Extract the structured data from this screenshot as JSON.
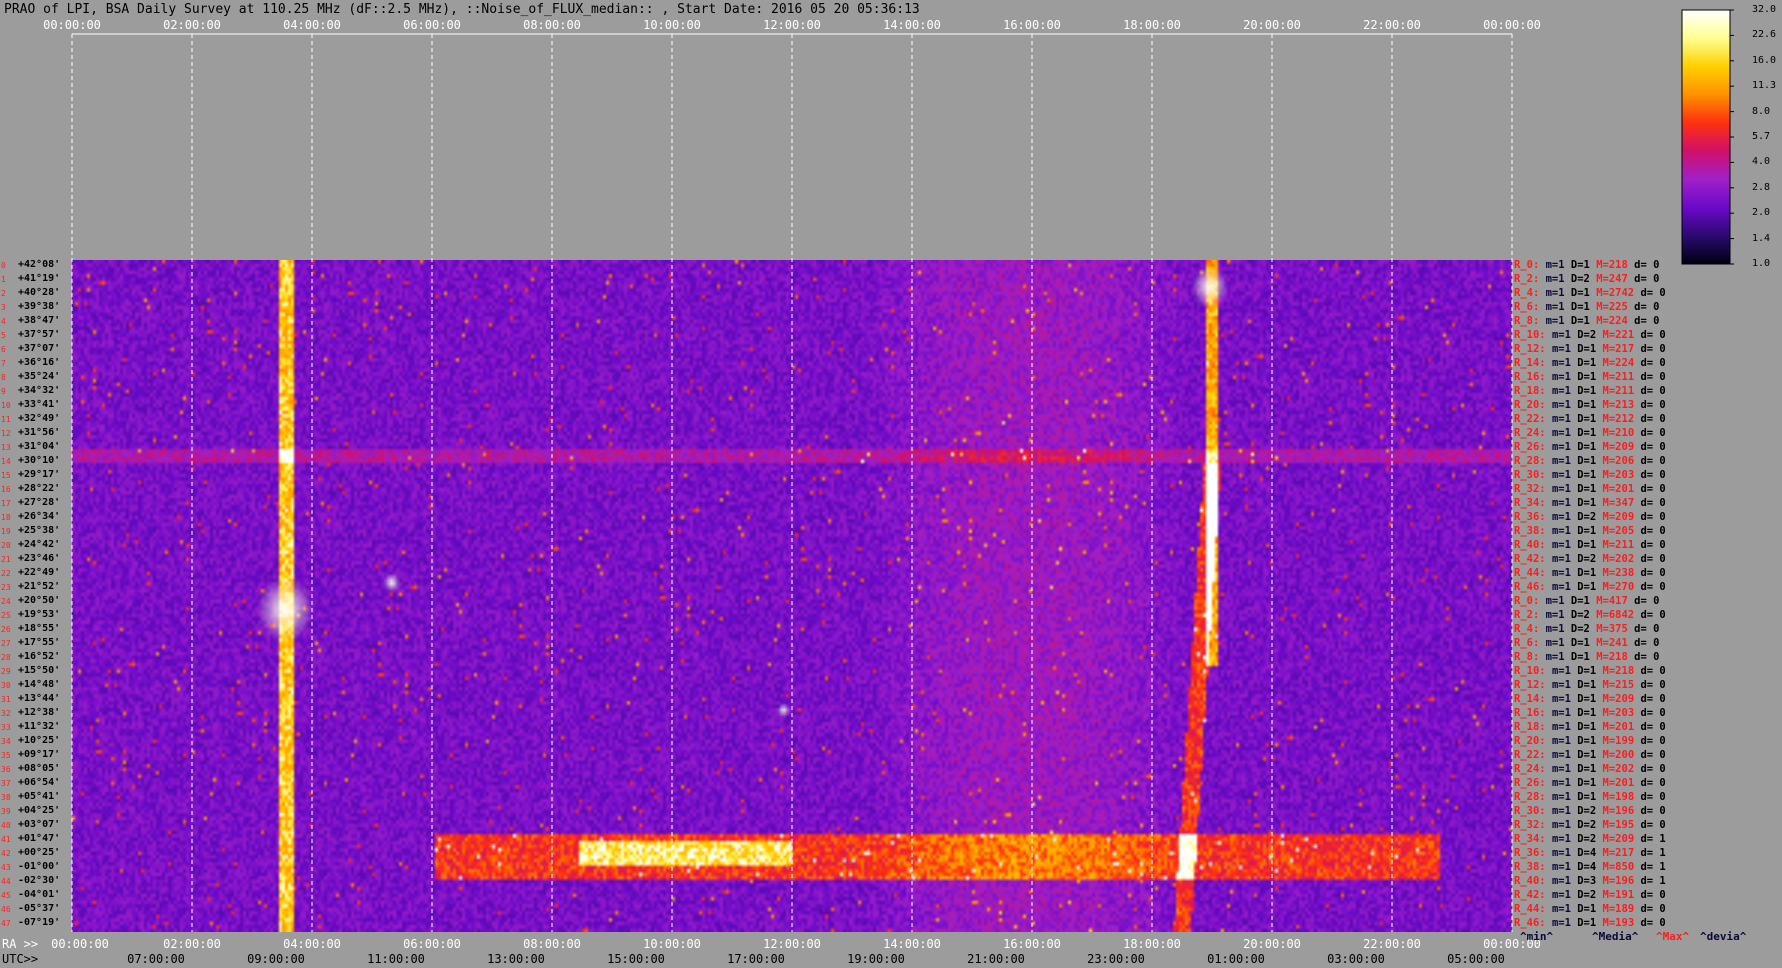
{
  "title": "PRAO of LPI, BSA Daily Survey at 110.25 MHz (dF::2.5 MHz), ::Noise_of_FLUX_median:: , Start Date: 2016 05 20 05:36:13",
  "chart_data": {
    "type": "heatmap",
    "title": "PRAO of LPI, BSA Daily Survey at 110.25 MHz (dF::2.5 MHz), ::Noise_of_FLUX_median:: , Start Date: 2016 05 20 05:36:13",
    "x_top_ticks": [
      "00:00:00",
      "02:00:00",
      "04:00:00",
      "06:00:00",
      "08:00:00",
      "10:00:00",
      "12:00:00",
      "14:00:00",
      "16:00:00",
      "18:00:00",
      "20:00:00",
      "22:00:00",
      "00:00:00"
    ],
    "x_ra_ticks": [
      "00:00:00",
      "02:00:00",
      "04:00:00",
      "06:00:00",
      "08:00:00",
      "10:00:00",
      "12:00:00",
      "14:00:00",
      "16:00:00",
      "18:00:00",
      "20:00:00",
      "22:00:00",
      "00:00:00"
    ],
    "x_utc_ticks": [
      "07:00:00",
      "09:00:00",
      "11:00:00",
      "13:00:00",
      "15:00:00",
      "17:00:00",
      "19:00:00",
      "21:00:00",
      "23:00:00",
      "01:00:00",
      "03:00:00",
      "05:00:00"
    ],
    "ra_prefix": "RA >>",
    "utc_prefix": "UTC>>",
    "declinations": [
      "+42°08'",
      "+41°19'",
      "+40°28'",
      "+39°38'",
      "+38°47'",
      "+37°57'",
      "+37°07'",
      "+36°16'",
      "+35°24'",
      "+34°32'",
      "+33°41'",
      "+32°49'",
      "+31°56'",
      "+31°04'",
      "+30°10'",
      "+29°17'",
      "+28°22'",
      "+27°28'",
      "+26°34'",
      "+25°38'",
      "+24°42'",
      "+23°46'",
      "+22°49'",
      "+21°52'",
      "+20°50'",
      "+19°53'",
      "+18°55'",
      "+17°55'",
      "+16°52'",
      "+15°50'",
      "+14°48'",
      "+13°44'",
      "+12°38'",
      "+11°32'",
      "+10°25'",
      "+09°17'",
      "+08°05'",
      "+06°54'",
      "+05°41'",
      "+04°25'",
      "+03°07'",
      "+01°47'",
      "+00°25'",
      "-01°00'",
      "-02°30'",
      "-04°01'",
      "-05°37'",
      "-07°19'"
    ],
    "row_indices": [
      "0",
      "1",
      "2",
      "3",
      "4",
      "5",
      "6",
      "7",
      "8",
      "9",
      "10",
      "11",
      "12",
      "13",
      "14",
      "15",
      "16",
      "17",
      "18",
      "19",
      "20",
      "21",
      "22",
      "23",
      "24",
      "25",
      "26",
      "27",
      "28",
      "29",
      "30",
      "31",
      "32",
      "33",
      "34",
      "35",
      "36",
      "37",
      "38",
      "39",
      "40",
      "41",
      "42",
      "43",
      "44",
      "45",
      "46",
      "47"
    ],
    "colorbar": {
      "ticks": [
        "32.0",
        "22.6",
        "16.0",
        "11.3",
        "8.0",
        "5.7",
        "4.0",
        "2.8",
        "2.0",
        "1.4",
        "1.0"
      ],
      "colors": [
        "#ffffff",
        "#ffff90",
        "#ffd000",
        "#ff9000",
        "#ff3010",
        "#d0106a",
        "#a020c8",
        "#6a0ac8",
        "#2a0a70",
        "#000010"
      ]
    },
    "stats": [
      {
        "r": "R_0:",
        "m": "m=1",
        "D": "D=1",
        "M": "M=218",
        "d": "d= 0"
      },
      {
        "r": "R_2:",
        "m": "m=1",
        "D": "D=2",
        "M": "M=247",
        "d": "d= 0"
      },
      {
        "r": "R_4:",
        "m": "m=1",
        "D": "D=1",
        "M": "M=2742",
        "d": "d= 0"
      },
      {
        "r": "R_6:",
        "m": "m=1",
        "D": "D=1",
        "M": "M=225",
        "d": "d= 0"
      },
      {
        "r": "R_8:",
        "m": "m=1",
        "D": "D=1",
        "M": "M=224",
        "d": "d= 0"
      },
      {
        "r": "R_10:",
        "m": "m=1",
        "D": "D=2",
        "M": "M=221",
        "d": "d= 0"
      },
      {
        "r": "R_12:",
        "m": "m=1",
        "D": "D=1",
        "M": "M=217",
        "d": "d= 0"
      },
      {
        "r": "R_14:",
        "m": "m=1",
        "D": "D=1",
        "M": "M=224",
        "d": "d= 0"
      },
      {
        "r": "R_16:",
        "m": "m=1",
        "D": "D=1",
        "M": "M=211",
        "d": "d= 0"
      },
      {
        "r": "R_18:",
        "m": "m=1",
        "D": "D=1",
        "M": "M=211",
        "d": "d= 0"
      },
      {
        "r": "R_20:",
        "m": "m=1",
        "D": "D=1",
        "M": "M=213",
        "d": "d= 0"
      },
      {
        "r": "R_22:",
        "m": "m=1",
        "D": "D=1",
        "M": "M=212",
        "d": "d= 0"
      },
      {
        "r": "R_24:",
        "m": "m=1",
        "D": "D=1",
        "M": "M=210",
        "d": "d= 0"
      },
      {
        "r": "R_26:",
        "m": "m=1",
        "D": "D=1",
        "M": "M=209",
        "d": "d= 0"
      },
      {
        "r": "R_28:",
        "m": "m=1",
        "D": "D=1",
        "M": "M=206",
        "d": "d= 0"
      },
      {
        "r": "R_30:",
        "m": "m=1",
        "D": "D=1",
        "M": "M=203",
        "d": "d= 0"
      },
      {
        "r": "R_32:",
        "m": "m=1",
        "D": "D=1",
        "M": "M=201",
        "d": "d= 0"
      },
      {
        "r": "R_34:",
        "m": "m=1",
        "D": "D=1",
        "M": "M=347",
        "d": "d= 0"
      },
      {
        "r": "R_36:",
        "m": "m=1",
        "D": "D=2",
        "M": "M=209",
        "d": "d= 0"
      },
      {
        "r": "R_38:",
        "m": "m=1",
        "D": "D=1",
        "M": "M=205",
        "d": "d= 0"
      },
      {
        "r": "R_40:",
        "m": "m=1",
        "D": "D=1",
        "M": "M=211",
        "d": "d= 0"
      },
      {
        "r": "R_42:",
        "m": "m=1",
        "D": "D=2",
        "M": "M=202",
        "d": "d= 0"
      },
      {
        "r": "R_44:",
        "m": "m=1",
        "D": "D=1",
        "M": "M=238",
        "d": "d= 0"
      },
      {
        "r": "R_46:",
        "m": "m=1",
        "D": "D=1",
        "M": "M=270",
        "d": "d= 0"
      },
      {
        "r": "R_0:",
        "m": "m=1",
        "D": "D=1",
        "M": "M=417",
        "d": "d= 0"
      },
      {
        "r": "R_2:",
        "m": "m=1",
        "D": "D=2",
        "M": "M=6842",
        "d": "d= 0"
      },
      {
        "r": "R_4:",
        "m": "m=1",
        "D": "D=2",
        "M": "M=375",
        "d": "d= 0"
      },
      {
        "r": "R_6:",
        "m": "m=1",
        "D": "D=1",
        "M": "M=241",
        "d": "d= 0"
      },
      {
        "r": "R_8:",
        "m": "m=1",
        "D": "D=1",
        "M": "M=218",
        "d": "d= 0"
      },
      {
        "r": "R_10:",
        "m": "m=1",
        "D": "D=1",
        "M": "M=218",
        "d": "d= 0"
      },
      {
        "r": "R_12:",
        "m": "m=1",
        "D": "D=1",
        "M": "M=215",
        "d": "d= 0"
      },
      {
        "r": "R_14:",
        "m": "m=1",
        "D": "D=1",
        "M": "M=209",
        "d": "d= 0"
      },
      {
        "r": "R_16:",
        "m": "m=1",
        "D": "D=1",
        "M": "M=203",
        "d": "d= 0"
      },
      {
        "r": "R_18:",
        "m": "m=1",
        "D": "D=1",
        "M": "M=201",
        "d": "d= 0"
      },
      {
        "r": "R_20:",
        "m": "m=1",
        "D": "D=1",
        "M": "M=199",
        "d": "d= 0"
      },
      {
        "r": "R_22:",
        "m": "m=1",
        "D": "D=1",
        "M": "M=200",
        "d": "d= 0"
      },
      {
        "r": "R_24:",
        "m": "m=1",
        "D": "D=1",
        "M": "M=202",
        "d": "d= 0"
      },
      {
        "r": "R_26:",
        "m": "m=1",
        "D": "D=1",
        "M": "M=201",
        "d": "d= 0"
      },
      {
        "r": "R_28:",
        "m": "m=1",
        "D": "D=1",
        "M": "M=198",
        "d": "d= 0"
      },
      {
        "r": "R_30:",
        "m": "m=1",
        "D": "D=2",
        "M": "M=196",
        "d": "d= 0"
      },
      {
        "r": "R_32:",
        "m": "m=1",
        "D": "D=2",
        "M": "M=195",
        "d": "d= 0"
      },
      {
        "r": "R_34:",
        "m": "m=1",
        "D": "D=2",
        "M": "M=209",
        "d": "d= 1"
      },
      {
        "r": "R_36:",
        "m": "m=1",
        "D": "D=4",
        "M": "M=217",
        "d": "d= 1"
      },
      {
        "r": "R_38:",
        "m": "m=1",
        "D": "D=4",
        "M": "M=850",
        "d": "d= 1"
      },
      {
        "r": "R_40:",
        "m": "m=1",
        "D": "D=3",
        "M": "M=196",
        "d": "d= 1"
      },
      {
        "r": "R_42:",
        "m": "m=1",
        "D": "D=2",
        "M": "M=191",
        "d": "d= 0"
      },
      {
        "r": "R_44:",
        "m": "m=1",
        "D": "D=1",
        "M": "M=189",
        "d": "d= 0"
      },
      {
        "r": "R_46:",
        "m": "m=1",
        "D": "D=1",
        "M": "M=193",
        "d": "d= 0"
      }
    ],
    "footer": {
      "min": "^min^",
      "median": "^Media^",
      "max": "^Max^",
      "dev": "^devia^"
    }
  }
}
